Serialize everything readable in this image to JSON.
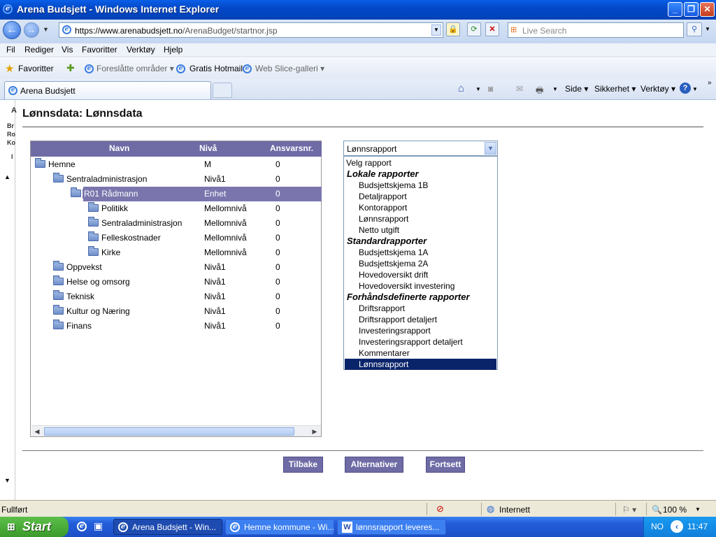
{
  "window": {
    "title": "Arena Budsjett - Windows Internet Explorer"
  },
  "address": {
    "url_prefix": "https://www.",
    "url_domain": "arenabudsjett.no",
    "url_path": "/ArenaBudget/startnor.jsp"
  },
  "search": {
    "placeholder": "Live Search"
  },
  "menu": [
    "Fil",
    "Rediger",
    "Vis",
    "Favoritter",
    "Verktøy",
    "Hjelp"
  ],
  "favbar": {
    "favoritter": "Favoritter",
    "suggested": "Foreslåtte områder",
    "hotmail": "Gratis Hotmail",
    "webslice": "Web Slice-galleri"
  },
  "tab": {
    "label": "Arena Budsjett"
  },
  "commandbar": {
    "side": "Side",
    "sikkerhet": "Sikkerhet",
    "verktoy": "Verktøy"
  },
  "leftstrip": [
    "A",
    "Br",
    "Ro",
    "Ko",
    "I"
  ],
  "page": {
    "title": "Lønnsdata: Lønnsdata"
  },
  "tree": {
    "headers": {
      "name": "Navn",
      "level": "Nivå",
      "ansvar": "Ansvarsnr."
    },
    "rows": [
      {
        "name": "Hemne",
        "level": "M",
        "ansvar": "0",
        "depth": 0
      },
      {
        "name": "Sentraladministrasjon",
        "level": "Nivå1",
        "ansvar": "0",
        "depth": 1
      },
      {
        "name": "R01 Rådmann",
        "level": "Enhet",
        "ansvar": "0",
        "depth": 2,
        "selected": true
      },
      {
        "name": "Politikk",
        "level": "Mellomnivå",
        "ansvar": "0",
        "depth": 3
      },
      {
        "name": "Sentraladministrasjon",
        "level": "Mellomnivå",
        "ansvar": "0",
        "depth": 3
      },
      {
        "name": "Felleskostnader",
        "level": "Mellomnivå",
        "ansvar": "0",
        "depth": 3
      },
      {
        "name": "Kirke",
        "level": "Mellomnivå",
        "ansvar": "0",
        "depth": 3
      },
      {
        "name": "Oppvekst",
        "level": "Nivå1",
        "ansvar": "0",
        "depth": 1
      },
      {
        "name": "Helse og omsorg",
        "level": "Nivå1",
        "ansvar": "0",
        "depth": 1
      },
      {
        "name": "Teknisk",
        "level": "Nivå1",
        "ansvar": "0",
        "depth": 1
      },
      {
        "name": "Kultur og Næring",
        "level": "Nivå1",
        "ansvar": "0",
        "depth": 1
      },
      {
        "name": "Finans",
        "level": "Nivå1",
        "ansvar": "0",
        "depth": 1
      }
    ]
  },
  "report_select": {
    "value": "Lønnsrapport",
    "options": [
      {
        "label": "Velg rapport",
        "kind": "first"
      },
      {
        "label": "Lokale rapporter",
        "kind": "group"
      },
      {
        "label": "Budsjettskjema 1B",
        "kind": "item"
      },
      {
        "label": "Detaljrapport",
        "kind": "item"
      },
      {
        "label": "Kontorapport",
        "kind": "item"
      },
      {
        "label": "Lønnsrapport",
        "kind": "item"
      },
      {
        "label": "Netto utgift",
        "kind": "item"
      },
      {
        "label": "Standardrapporter",
        "kind": "group"
      },
      {
        "label": "Budsjettskjema 1A",
        "kind": "item"
      },
      {
        "label": "Budsjettskjema 2A",
        "kind": "item"
      },
      {
        "label": "Hovedoversikt drift",
        "kind": "item"
      },
      {
        "label": "Hovedoversikt investering",
        "kind": "item"
      },
      {
        "label": "Forhåndsdefinerte rapporter",
        "kind": "group"
      },
      {
        "label": "Driftsrapport",
        "kind": "item"
      },
      {
        "label": "Driftsrapport detaljert",
        "kind": "item"
      },
      {
        "label": "Investeringsrapport",
        "kind": "item"
      },
      {
        "label": "Investeringsrapport detaljert",
        "kind": "item"
      },
      {
        "label": "Kommentarer",
        "kind": "item"
      },
      {
        "label": "Lønnsrapport",
        "kind": "item",
        "selected": true
      }
    ]
  },
  "buttons": {
    "back": "Tilbake",
    "options": "Alternativer",
    "continue": "Fortsett"
  },
  "status": {
    "text": "Fullført",
    "zone": "Internett",
    "zoom": "100 %"
  },
  "taskbar": {
    "start": "Start",
    "tasks": [
      "Arena Budsjett - Win...",
      "Hemne kommune - Wi...",
      "lønnsrapport  leveres..."
    ],
    "lang": "NO",
    "clock": "11:47"
  }
}
